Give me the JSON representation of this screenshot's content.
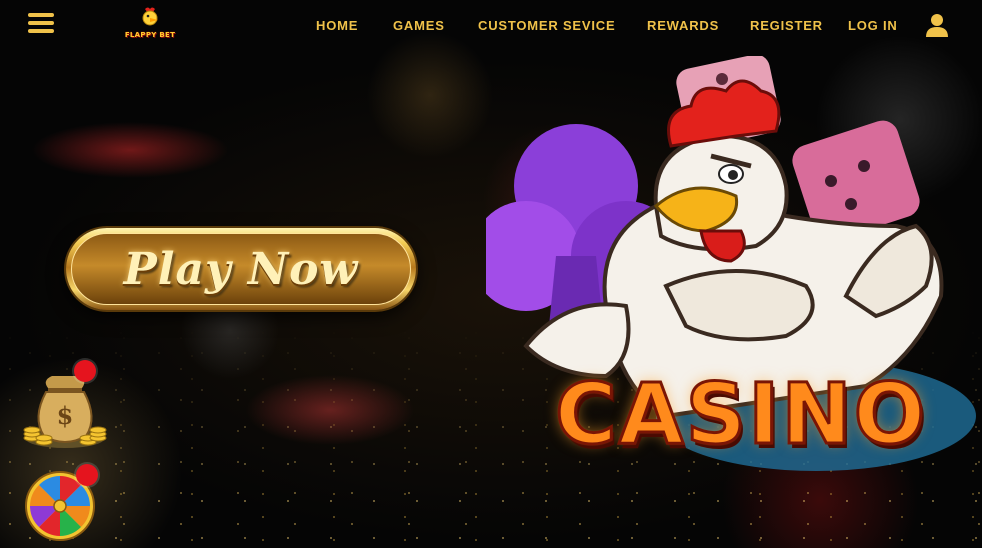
{
  "header": {
    "logo_text": "FLAPPY BET",
    "nav": [
      {
        "label": "HOME"
      },
      {
        "label": "GAMES"
      },
      {
        "label": "CUSTOMER SEVICE"
      },
      {
        "label": "REWARDS"
      },
      {
        "label": "REGISTER"
      },
      {
        "label": "LOG IN"
      }
    ],
    "icons": {
      "menu": "hamburger-icon",
      "user": "user-icon"
    }
  },
  "hero": {
    "cta_label": "Play Now",
    "banner_text": "CASINO"
  },
  "side_widgets": [
    {
      "name": "money-bag",
      "icon": "money-bag-icon",
      "has_notification": true
    },
    {
      "name": "lucky-wheel",
      "icon": "prize-wheel-icon",
      "has_notification": true
    }
  ],
  "colors": {
    "accent_gold": "#f0c24a",
    "background": "#050505",
    "notification_red": "#e5141e",
    "casino_orange": "#ff8a1c"
  }
}
